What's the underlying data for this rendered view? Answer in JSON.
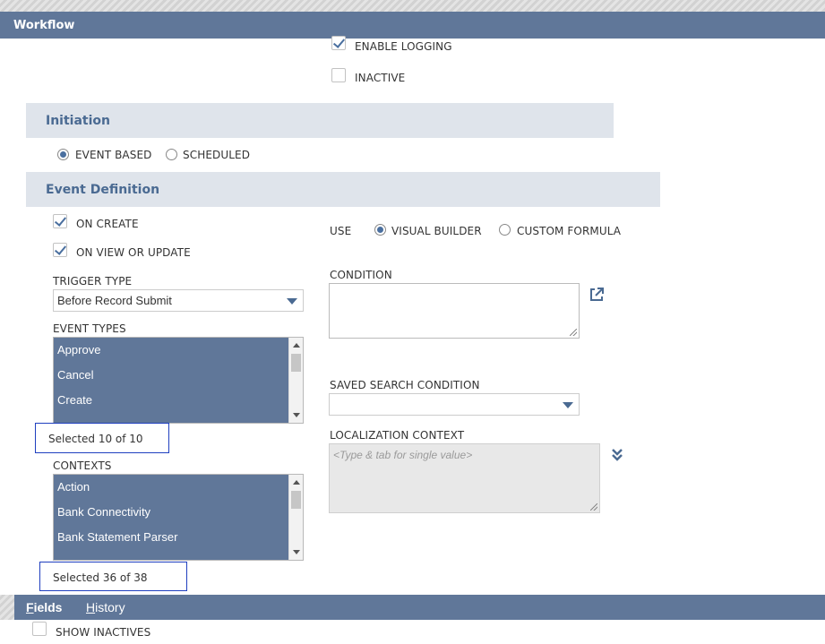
{
  "window": {
    "title": "Workflow"
  },
  "settings": {
    "enable_logging": {
      "label": "ENABLE LOGGING",
      "checked": true
    },
    "inactive": {
      "label": "INACTIVE",
      "checked": false
    }
  },
  "initiation": {
    "header": "Initiation",
    "options": [
      {
        "label": "EVENT BASED",
        "selected": true
      },
      {
        "label": "SCHEDULED",
        "selected": false
      }
    ]
  },
  "event_definition": {
    "header": "Event Definition",
    "on_create": {
      "label": "ON CREATE",
      "checked": true
    },
    "on_view_or_update": {
      "label": "ON VIEW OR UPDATE",
      "checked": true
    },
    "trigger_type": {
      "label": "TRIGGER TYPE",
      "value": "Before Record Submit"
    },
    "event_types": {
      "label": "EVENT TYPES",
      "items": [
        "Approve",
        "Cancel",
        "Create"
      ],
      "selected_text": "Selected 10 of 10"
    },
    "contexts": {
      "label": "CONTEXTS",
      "items": [
        "Action",
        "Bank Connectivity",
        "Bank Statement Parser"
      ],
      "selected_text": "Selected 36 of 38"
    },
    "use": {
      "label": "USE",
      "options": [
        {
          "label": "VISUAL BUILDER",
          "selected": true
        },
        {
          "label": "CUSTOM FORMULA",
          "selected": false
        }
      ]
    },
    "condition": {
      "label": "CONDITION",
      "value": ""
    },
    "saved_search_condition": {
      "label": "SAVED SEARCH CONDITION",
      "value": ""
    },
    "localization_context": {
      "label": "LOCALIZATION CONTEXT",
      "placeholder": "<Type & tab for single value>"
    }
  },
  "tabs": [
    {
      "first": "F",
      "rest": "ields",
      "active": true
    },
    {
      "first": "H",
      "rest": "istory",
      "active": false
    }
  ],
  "show_inactives": {
    "label": "SHOW INACTIVES",
    "checked": false
  },
  "colors": {
    "header": "#607799",
    "section": "#dfe4eb",
    "accent": "#4a6f9f",
    "highlight_box": "#1f3fbf"
  },
  "icons": [
    "external-link-icon",
    "double-chevron-down-icon",
    "dropdown-arrow-icon"
  ]
}
